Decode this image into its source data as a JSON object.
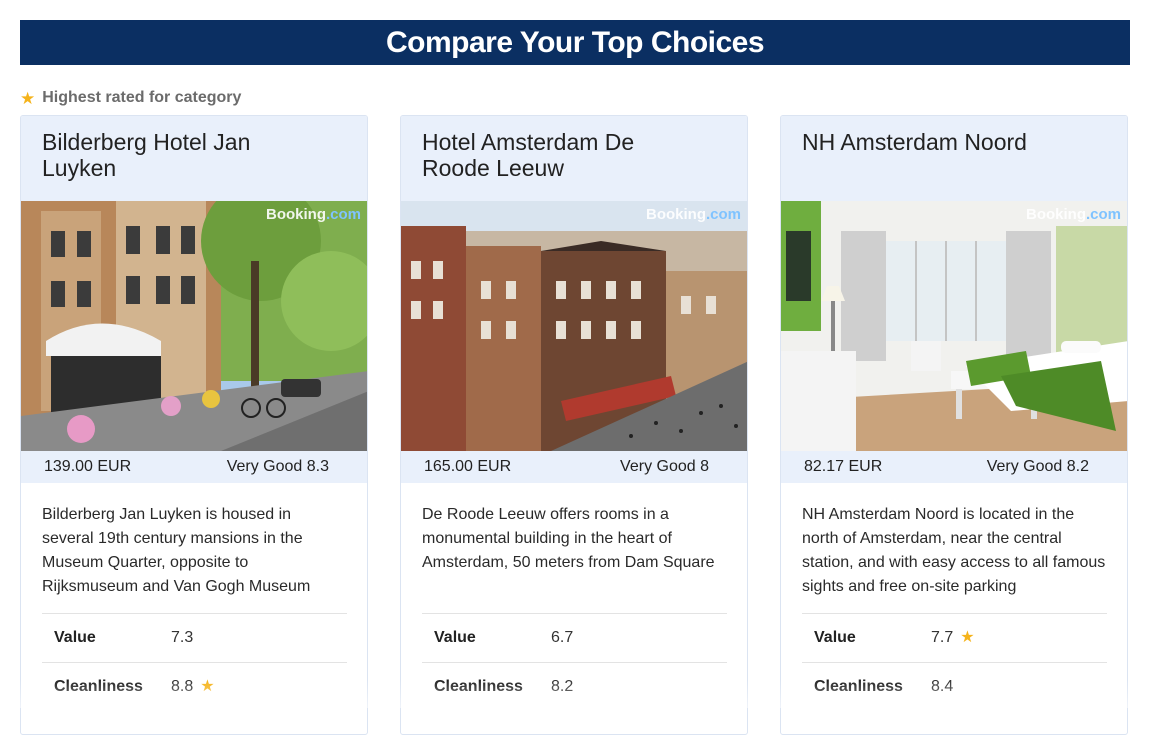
{
  "header": {
    "title": "Compare Your Top Choices"
  },
  "legend": {
    "icon": "star-icon",
    "label": "Highest rated for category",
    "star_color": "#f5b31b"
  },
  "colors": {
    "banner": "#0b2f62",
    "card_header": "#e9f0fb"
  },
  "watermark": {
    "brand": "Booking",
    "suffix": ".com"
  },
  "hotels": [
    {
      "name": "Bilderberg Hotel Jan Luyken",
      "price": "139.00 EUR",
      "rating": "Very Good 8.3",
      "description": "Bilderberg Jan Luyken is housed in several 19th century mansions in the Museum Quarter, opposite to Rijksmuseum and Van Gogh Museum",
      "scores": [
        {
          "label": "Value",
          "value": "7.3",
          "top": false
        },
        {
          "label": "Cleanliness",
          "value": "8.8",
          "top": true
        }
      ]
    },
    {
      "name": "Hotel Amsterdam De Roode Leeuw",
      "price": "165.00 EUR",
      "rating": "Very Good 8",
      "description": "De Roode Leeuw offers rooms in a monumental building in the heart of Amsterdam, 50 meters from Dam Square",
      "scores": [
        {
          "label": "Value",
          "value": "6.7",
          "top": false
        },
        {
          "label": "Cleanliness",
          "value": "8.2",
          "top": false
        }
      ]
    },
    {
      "name": "NH Amsterdam Noord",
      "price": "82.17 EUR",
      "rating": "Very Good 8.2",
      "description": "NH Amsterdam Noord is located in the north of Amsterdam, near the central station, and with easy access to all famous sights and free on-site parking",
      "scores": [
        {
          "label": "Value",
          "value": "7.7",
          "top": true
        },
        {
          "label": "Cleanliness",
          "value": "8.4",
          "top": false
        }
      ]
    }
  ]
}
